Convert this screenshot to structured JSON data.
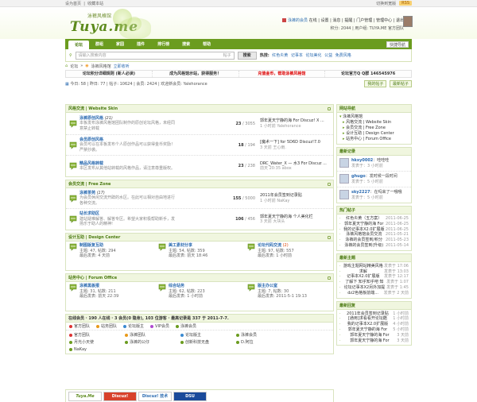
{
  "topbar": {
    "left": [
      "设为首页",
      "收藏本站"
    ],
    "right": "切换到宽版",
    "rss": "RSS"
  },
  "header": {
    "logo_cn": "泳裤风格馆",
    "logo_en": "Tuya.me",
    "user_line1": [
      "泳裤的会员",
      "在线",
      "设置",
      "消息",
      "提醒",
      "门户管理",
      "管理中心",
      "退出"
    ],
    "user_line2": {
      "points_label": "积分: 2044",
      "group_label": "用户组: TUYA.ME 官方团队"
    }
  },
  "nav": {
    "items": [
      "论坛",
      "群组",
      "家园",
      "插件",
      "排行榜",
      "搜索",
      "帮助"
    ],
    "active": 0,
    "quick_nav": "快捷导航"
  },
  "search": {
    "placeholder": "请输入搜索内容",
    "scope": "帖子",
    "button": "搜索",
    "hot_label": "热搜:",
    "hot": [
      "红色炎黄",
      "记事本",
      "论坛美化",
      "公益",
      "免费风格"
    ]
  },
  "breadcrumb": {
    "home": "论坛",
    "current": "泳裤风格馆",
    "link": "立即收听"
  },
  "announcements": [
    "论坛积分详细规则 (新人必读)",
    "成为风格馆示站，获得服务！",
    "充值金币，帮助泳裤风格馆",
    "论坛官方Q Q群 146545976"
  ],
  "stats": {
    "text": "今日: 58 | 昨日: 77 | 帖子: 10624 | 会员: 2424 | 欢迎新会员: Yalehorance",
    "buttons": [
      "我的帖子",
      "最新帖子"
    ]
  },
  "categories": [
    {
      "title": "风格交流 | Website Skin",
      "forums": [
        {
          "name": "泳裤原创风格",
          "new": "(21)",
          "desc1": "本板发布泳裤风格馆团队制作的原创论坛风格，未经同",
          "desc2": "意禁止转载",
          "count": "23",
          "total": "/ 3055",
          "last_title": "郭年夏天宁静的海 For Discuz! X ...",
          "last_time": "1 小时前 Yalehorance"
        },
        {
          "name": "会员原创风格",
          "new": "",
          "desc1": "会员可以在本板发布个人原创作品可以获得金币奖励！",
          "desc2": "严禁抄袭。",
          "count": "18",
          "total": "/ 194",
          "last_title": "[魔术一下] for 5D6D Discuz!7.0",
          "last_time": "3 天前 王心雨."
        },
        {
          "name": "精品风格转载",
          "new": "",
          "desc1": "本区发布从其他站转载的风格作品，请注意尊重版权。",
          "desc2": "",
          "count": "23",
          "total": "/ 238",
          "last_title": "DRC_Water_X — 水3 For Discuz ...",
          "last_time": "前天 20:35 abox"
        }
      ]
    },
    {
      "title": "会员交流 | Free Zone",
      "forums": [
        {
          "name": "泳裤茶苑",
          "new": "(17)",
          "desc1": "为会员休闲交流开辟的水区。在此可以相对自由地进行",
          "desc2": "各种交流。",
          "count": "155",
          "total": "/ 5000",
          "last_title": "2011年会员签到记录贴",
          "last_time": "1 小时前 NaKay"
        },
        {
          "name": "站长求助区",
          "new": "",
          "desc1": "建站疑难解答、解答专区。希望大家积极帮助新手，发",
          "desc2": "扬乐于助人的精神!",
          "count": "106",
          "total": "/ 456",
          "last_title": "郭年夏天宁静的海 个人美化栏",
          "last_time": "3 天前 大块头"
        }
      ]
    }
  ],
  "grid_categories": [
    {
      "title": "设计互助 | Design Center",
      "forums": [
        {
          "name": "制图版复互助",
          "topics": "主题: 47, 帖数: 294",
          "last": "最后发表: 4 天前"
        },
        {
          "name": "美工素材分享",
          "topics": "主题: 54, 帖数: 359",
          "last": "最后发表: 前天 18:46"
        },
        {
          "name": "论坛代码交流",
          "new": "(2)",
          "topics": "主题: 97, 帖数: 557",
          "last": "最后发表: 1 小时前"
        }
      ]
    },
    {
      "title": "站务中心 | Forum Office",
      "forums": [
        {
          "name": "泳裤黑板报",
          "topics": "主题: 31, 帖数: 211",
          "last": "最后发表: 前天 22:39"
        },
        {
          "name": "综合站务",
          "topics": "主题: 62, 帖数: 223",
          "last": "最后发表: 1 小时前"
        },
        {
          "name": "版主办公室",
          "topics": "主题: 7, 帖数: 30",
          "last": "最后发表: 2011-5-1 19:13"
        }
      ]
    }
  ],
  "online": {
    "title": "在线会员 · 190 人在线 · 3 会员(0 隐身), 103 位游客 · 最高记录是 337 于 2011-7-7.",
    "legend": [
      "官方团队",
      "站务团队",
      "论坛版主",
      "VIP会员",
      "泳裤会员"
    ],
    "users": [
      "官方团队",
      "泳裤团队",
      "论坛版主",
      "泳裤会员",
      "月光小天使",
      "泳裤的公仔",
      "创新科技无盘",
      "D.阿拉",
      "NaKay"
    ]
  },
  "links": [
    "Tuya.Me",
    "Discuz!",
    "Discuz! 技术",
    "DSU"
  ],
  "side": {
    "nav_title": "网站导航",
    "tree": [
      "泳裤风格馆",
      "风格交流 | Website Skin",
      "会员交流 | Free Zone",
      "设计互助 | Design Center",
      "站务中心 | Forum Office"
    ],
    "recent_title": "最新记录",
    "posts": [
      {
        "name": "hkxy0002",
        "text": "：哇哇哇",
        "time": "发表于：3 小时前"
      },
      {
        "name": "ghugo",
        "text": "：发时候一段时间",
        "time": "发表于：5 小时前"
      },
      {
        "name": "sky2227",
        "text": "：在吗来了一哦哦",
        "time": "发表于：5 小时前"
      }
    ],
    "hot_title": "热门帖子",
    "hot": [
      [
        "红色炎黄（五方案）",
        "2011-06-25"
      ],
      [
        "郭年夏天宁静的海 For",
        "2011-06-25"
      ],
      [
        "我的记事本X2.0扩展版",
        "2011-06-25"
      ],
      [
        "泳裤风格馆会员交流",
        "2011-05-21"
      ],
      [
        "泳裤的会员签到/积分",
        "2011-05-23"
      ],
      [
        "泳裤的会员签到(升级)",
        "2011-05-14"
      ]
    ],
    "feature_title": "最新主题",
    "features": [
      [
        "游戏主题网站精美风格",
        "发表于 17:06"
      ],
      [
        "求解",
        "发表于 13:03"
      ],
      [
        "记事本X2.0扩展版",
        "发表于 12:17"
      ],
      [
        "了解下 知乎知乎吧 知",
        "发表于 1:07"
      ],
      [
        "论坛记事本X2另外加提",
        "发表于 1:45"
      ],
      [
        "dz2色格板前端...",
        "发表于 2 天前"
      ]
    ],
    "reply_title": "最新回复",
    "replies": [
      [
        "2011年会员签到记录贴",
        "1 小时前"
      ],
      [
        "[通用]求看看开论坛酷",
        "1 小时前"
      ],
      [
        "我的记事本X2.0扩展版",
        "4 小时前"
      ],
      [
        "郭年夏天宁静的海 For",
        "5 小时前"
      ],
      [
        "郭年夏天宁静的海 For",
        "3 天前"
      ],
      [
        "郭年夏天宁静的海 For",
        "3 天前"
      ]
    ]
  },
  "colors": {
    "brand": "#6b9c1f",
    "link": "#2a6ab0",
    "alert": "#d00000"
  }
}
